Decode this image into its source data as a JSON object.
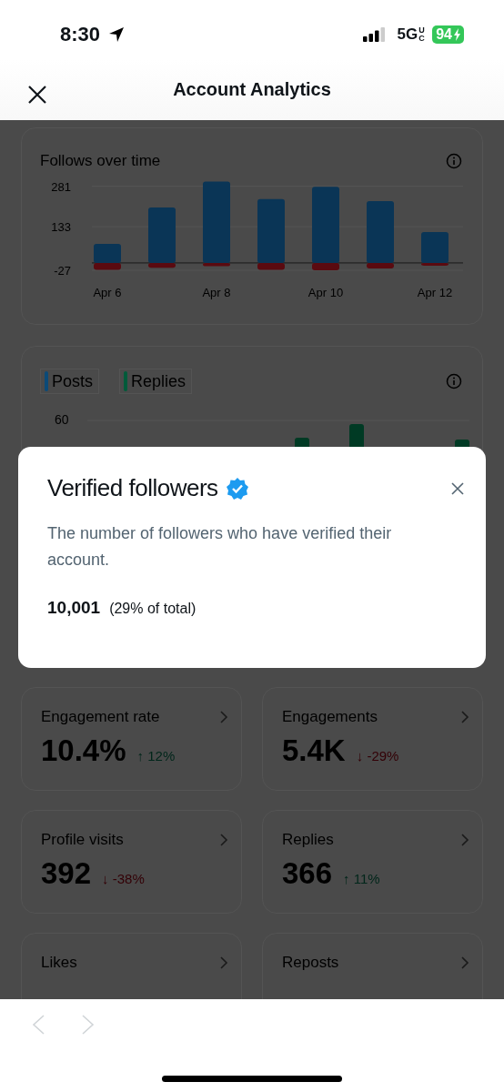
{
  "status_bar": {
    "time": "8:30",
    "network": "5G",
    "network_suffix": "UC",
    "battery": "94"
  },
  "header": {
    "title": "Account Analytics"
  },
  "follows_card": {
    "title": "Follows over time",
    "chart_data": {
      "type": "bar",
      "stacked": true,
      "categories": [
        "Apr 6",
        null,
        "Apr 8",
        null,
        "Apr 10",
        null,
        "Apr 12"
      ],
      "series": [
        {
          "color": "#0a3556",
          "values": [
            70,
            203,
            298,
            234,
            279,
            227,
            113
          ]
        },
        {
          "color": "#5a0a10",
          "values": [
            -25,
            -18,
            -12,
            -25,
            -27,
            -20,
            -10
          ]
        }
      ],
      "ylim": [
        -27,
        300
      ],
      "yticks": [
        -27,
        133,
        281
      ]
    }
  },
  "activity_card": {
    "legend": [
      {
        "label": "Posts",
        "color": "#0b4a78"
      },
      {
        "label": "Replies",
        "color": "#005a3a"
      }
    ],
    "tick": "60"
  },
  "metrics": [
    {
      "label": "Engagement rate",
      "value": "10.4%",
      "change": "↑ 12%",
      "positive": true
    },
    {
      "label": "Engagements",
      "value": "5.4K",
      "change": "↓ -29%",
      "positive": false
    },
    {
      "label": "Profile visits",
      "value": "392",
      "change": "↓ -38%",
      "positive": false
    },
    {
      "label": "Replies",
      "value": "366",
      "change": "↑ 11%",
      "positive": true
    },
    {
      "label": "Likes"
    },
    {
      "label": "Reposts"
    }
  ],
  "modal": {
    "title": "Verified followers",
    "verified": true,
    "description": "The number of followers who have verified their account.",
    "value": "10,001",
    "share": "(29% of total)"
  },
  "bottom_bar": {
    "back_disabled": true,
    "forward_disabled": true
  }
}
